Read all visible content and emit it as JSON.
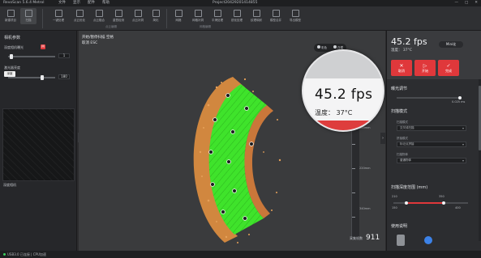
{
  "titlebar": {
    "app_name": "RevoScan 5.6.4 Metrol",
    "menu": [
      "文件",
      "显示",
      "配件",
      "帮助"
    ],
    "project": "Project20429201414855",
    "window_controls": [
      "—",
      "□",
      "✕"
    ]
  },
  "toolbar": {
    "buttons": [
      "新建项目",
      "扫描",
      "一键处理",
      "点云优化",
      "点云融合",
      "重叠检测",
      "点云补洞",
      "简化",
      "网格",
      "网格补洞",
      "平滑处理",
      "锐化处理",
      "纹理映射",
      "模型合并",
      "导出模型"
    ],
    "groups": [
      "点云编辑",
      "网格编辑"
    ]
  },
  "left_panel": {
    "title": "相机参数",
    "depth_exposure_label": "深度相机曝光",
    "depth_exposure_value": "1",
    "auto_badge": "M",
    "brightness_label": "激光器亮度",
    "brightness_value": "180",
    "tooltip": "深度",
    "camera_label": "深度相机",
    "collapse_glyph": "‹"
  },
  "viewport": {
    "info_line1": "开始/暂停扫描 空格",
    "info_line2": "取消 ESC",
    "toggle_left": "彩色",
    "toggle_right": "白模",
    "collapse_glyph": "›",
    "ruler_labels": [
      "100mm",
      "220mm",
      "340mm"
    ],
    "frame_label": "采集帧数",
    "frame_count": "911"
  },
  "magnifier": {
    "fps": "45.2 fps",
    "temperature": "温度：  37°C"
  },
  "right_panel": {
    "fps": "45.2 fps",
    "temperature": "温度： 37°C",
    "mini_button": "Mini化",
    "actions": [
      {
        "glyph": "✕",
        "label": "取消"
      },
      {
        "glyph": "▷",
        "label": "开始"
      },
      {
        "glyph": "✓",
        "label": "完成"
      }
    ],
    "section_exposure": "曝光调节",
    "exposure_value": "0.025 ms",
    "section_scan_mode": "扫描模式",
    "scan_fields": [
      {
        "label": "扫描模式",
        "value": "交叉线扫描"
      },
      {
        "label": "拼接模式",
        "value": "标记点拼接"
      },
      {
        "label": "扫描物体",
        "value": "普通物体"
      }
    ],
    "section_distance": "扫描深度范围 (mm)",
    "distance_min_label": "210",
    "distance_max_label": "350",
    "distance_low": "150",
    "distance_high": "400",
    "section_help": "使用说明"
  },
  "statusbar": {
    "text": "USB3.0 已连接 | CPU加速"
  },
  "colors": {
    "accent_red": "#e0383b",
    "scan_green": "#3ee02a",
    "scan_orange": "#e08a3a"
  }
}
